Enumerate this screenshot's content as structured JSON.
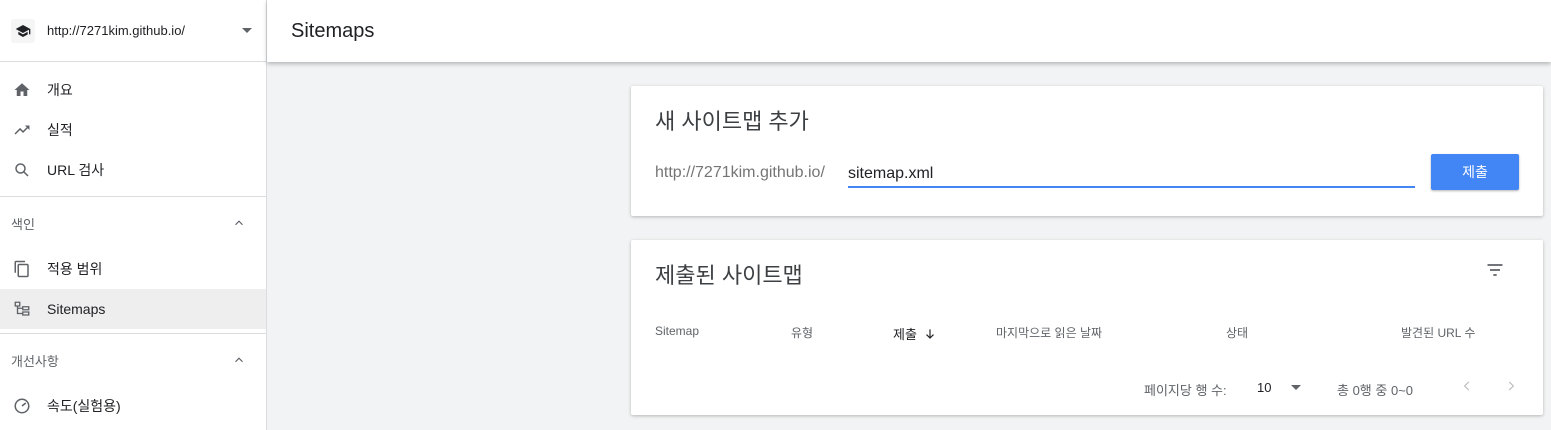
{
  "property": {
    "url": "http://7271kim.github.io/",
    "logo_icon": "graduation-cap-icon"
  },
  "sidebar": {
    "top_items": [
      {
        "label": "개요",
        "icon": "home-icon"
      },
      {
        "label": "실적",
        "icon": "trending-up-icon"
      },
      {
        "label": "URL 검사",
        "icon": "search-icon"
      }
    ],
    "index_section": {
      "title": "색인",
      "items": [
        {
          "label": "적용 범위",
          "icon": "copy-icon"
        },
        {
          "label": "Sitemaps",
          "icon": "sitemap-icon",
          "active": true
        }
      ]
    },
    "enhancements_section": {
      "title": "개선사항",
      "items": [
        {
          "label": "속도(실험용)",
          "icon": "speedometer-icon"
        }
      ]
    }
  },
  "header": {
    "title": "Sitemaps"
  },
  "add_card": {
    "title": "새 사이트맵 추가",
    "prefix": "http://7271kim.github.io/",
    "input_value": "sitemap.xml",
    "submit_label": "제출"
  },
  "submitted_card": {
    "title": "제출된 사이트맵",
    "columns": [
      "Sitemap",
      "유형",
      "제출",
      "마지막으로 읽은 날짜",
      "상태",
      "발견된 URL 수"
    ],
    "sorted_column": "제출",
    "rows_per_page_label": "페이지당 행 수:",
    "rows_per_page_value": "10",
    "pagination_text": "총 0행 중 0~0"
  },
  "colors": {
    "accent": "#4285f4",
    "active_bg": "#eeeeee"
  }
}
